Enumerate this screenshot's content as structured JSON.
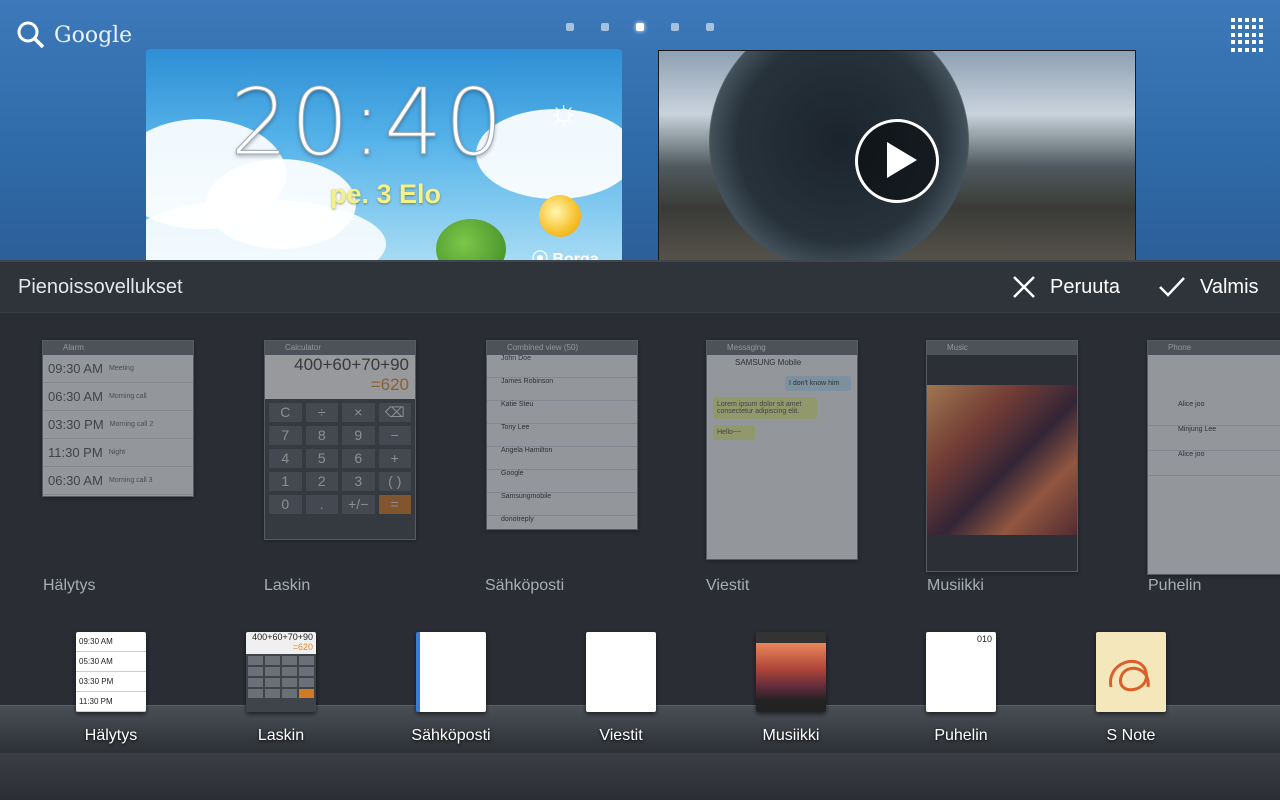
{
  "home": {
    "search_label": "Google",
    "page_dots": 5,
    "active_dot": 3,
    "clock_widget": {
      "time": "20:40",
      "date": "pe. 3 Elo",
      "location": "Borga"
    }
  },
  "picker": {
    "title": "Pienoissovellukset",
    "cancel_label": "Peruuta",
    "done_label": "Valmis",
    "widgets": [
      {
        "label": "Hälytys",
        "header": "Alarm"
      },
      {
        "label": "Laskin",
        "header": "Calculator"
      },
      {
        "label": "Sähköposti",
        "header": "Combined view (50)"
      },
      {
        "label": "Viestit",
        "header": "Messaging"
      },
      {
        "label": "Musiikki",
        "header": "Music"
      },
      {
        "label": "Puhelin",
        "header": "Phone"
      }
    ],
    "alarm_rows": [
      {
        "time": "09:30 AM",
        "name": "Meeting"
      },
      {
        "time": "06:30 AM",
        "name": "Morning call"
      },
      {
        "time": "03:30 PM",
        "name": "Morning call 2"
      },
      {
        "time": "11:30 PM",
        "name": "Night"
      },
      {
        "time": "06:30 AM",
        "name": "Morning call 3"
      }
    ],
    "calc_display": {
      "expr": "400+60+70+90",
      "result": "=620"
    },
    "calc_keys": [
      "C",
      "÷",
      "×",
      "⌫",
      "7",
      "8",
      "9",
      "−",
      "4",
      "5",
      "6",
      "+",
      "1",
      "2",
      "3",
      "( )",
      "0",
      ".",
      "+/−",
      "="
    ],
    "mail_rows": [
      "John Doe",
      "James Robinson",
      "Katie Steu",
      "Tony Lee",
      "Angela Hamilton",
      "Google",
      "Samsungmobile",
      "donotreply"
    ],
    "messages": {
      "contact": "SAMSUNG Mobile",
      "bubble1": "I don't know him",
      "bubble2": "Lorem ipsum dolor sit amet consectetur adipiscing elit.",
      "bubble3": "Hello~~"
    },
    "phone_rows": [
      "Alice joo",
      "Minjung Lee",
      "Alice joo"
    ]
  },
  "dock": [
    {
      "label": "Hälytys"
    },
    {
      "label": "Laskin"
    },
    {
      "label": "Sähköposti"
    },
    {
      "label": "Viestit"
    },
    {
      "label": "Musiikki"
    },
    {
      "label": "Puhelin"
    },
    {
      "label": "S Note"
    }
  ],
  "dock_icons": {
    "alarm_times": [
      "09:30 AM",
      "05:30 AM",
      "03:30 PM",
      "11:30 PM"
    ],
    "calc_expr": "400+60+70+90",
    "calc_result": "=620",
    "phone_number": "010"
  }
}
